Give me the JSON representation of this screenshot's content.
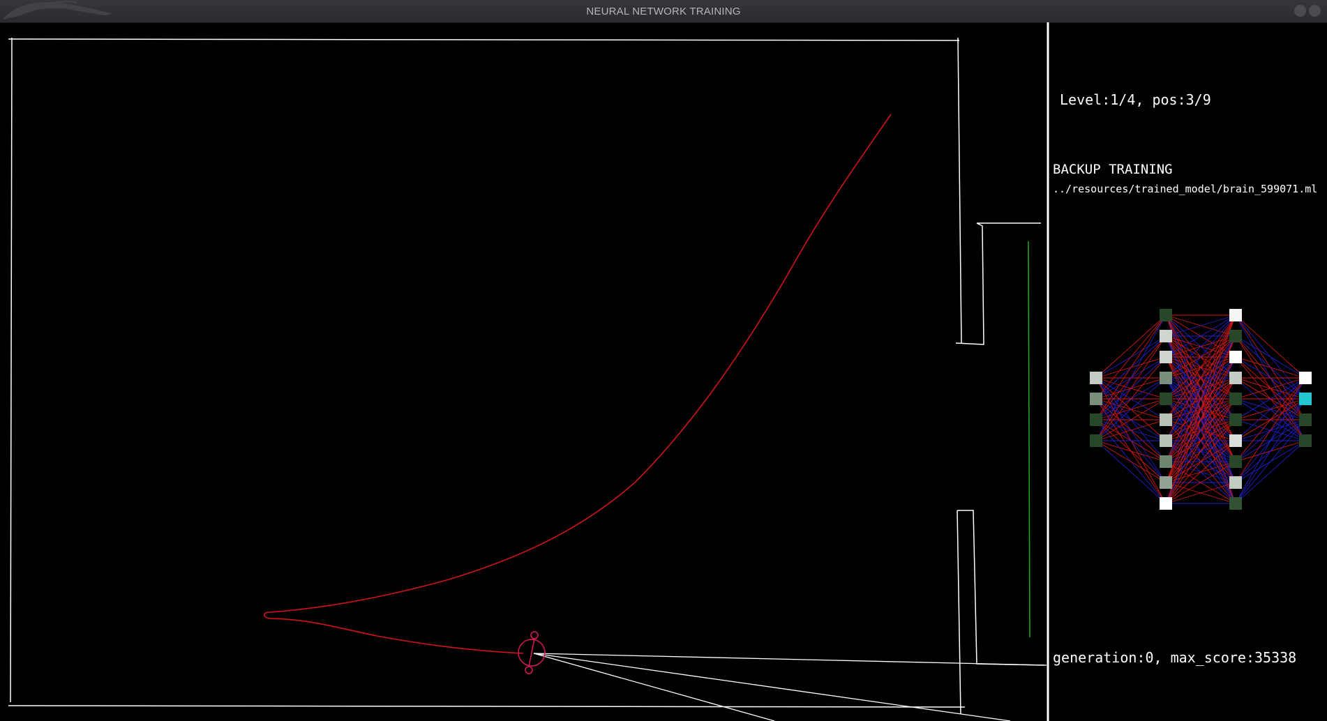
{
  "window": {
    "title": "NEURAL NETWORK TRAINING",
    "logo_icon": "dragon-logo-icon",
    "controls": [
      "minimize-icon",
      "close-icon"
    ]
  },
  "hud": {
    "level_text": "Level:1/4, pos:3/9",
    "backup_title": "BACKUP TRAINING",
    "model_path": "../resources/trained_model/brain_599071.ml",
    "generation_text": "generation:0, max_score:35338"
  },
  "network": {
    "layers": [
      {
        "name": "input",
        "activations": [
          0.75,
          0.45,
          0.1,
          0.1
        ]
      },
      {
        "name": "hidden-1",
        "activations": [
          0.1,
          0.8,
          0.8,
          0.45,
          0.1,
          0.7,
          0.7,
          0.4,
          0.55,
          1.0
        ]
      },
      {
        "name": "hidden-2",
        "activations": [
          0.95,
          0.1,
          1.0,
          0.75,
          0.1,
          0.1,
          0.85,
          0.1,
          0.75,
          0.15
        ]
      },
      {
        "name": "output",
        "activations": [
          1.0,
          "active",
          0.1,
          0.1
        ]
      }
    ]
  },
  "colors": {
    "background": "#000000",
    "walls": "#ffffff",
    "trail": "#d0141a",
    "agent": "#d8185a",
    "goal_line": "#22aa22",
    "weight_positive": "#d01818",
    "weight_negative": "#2020c8",
    "neuron_low": "#0e3310",
    "neuron_active_output": "#22c8d0"
  }
}
